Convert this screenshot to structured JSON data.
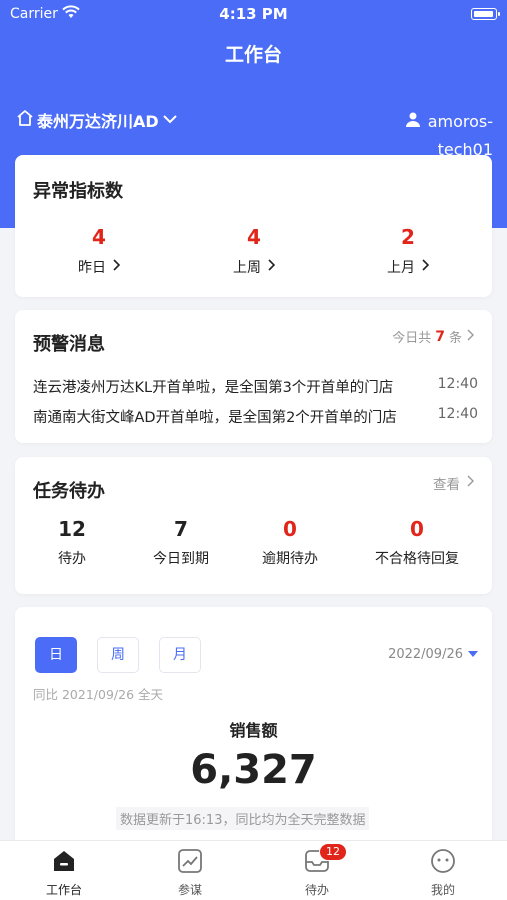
{
  "status_bar": {
    "carrier": "Carrier",
    "time": "4:13 PM"
  },
  "nav": {
    "title": "工作台"
  },
  "store": {
    "name": "泰州万达济川AD"
  },
  "user": {
    "name_line1": "amoros-",
    "name_line2": "tech01"
  },
  "abnormal": {
    "title": "异常指标数",
    "items": [
      {
        "value": "4",
        "label": "昨日"
      },
      {
        "value": "4",
        "label": "上周"
      },
      {
        "value": "2",
        "label": "上月"
      }
    ]
  },
  "alerts": {
    "title": "预警消息",
    "count_prefix": "今日共",
    "count": "7",
    "count_suffix": "条",
    "items": [
      {
        "text": "连云港凌州万达KL开首单啦，是全国第3个开首单的门店",
        "time": "12:40"
      },
      {
        "text": "南通南大街文峰AD开首单啦，是全国第2个开首单的门店",
        "time": "12:40"
      }
    ]
  },
  "tasks": {
    "title": "任务待办",
    "view_label": "查看",
    "items": [
      {
        "value": "12",
        "label": "待办",
        "color": "#222222"
      },
      {
        "value": "7",
        "label": "今日到期",
        "color": "#222222"
      },
      {
        "value": "0",
        "label": "逾期待办",
        "color": "#e1251b"
      },
      {
        "value": "0",
        "label": "不合格待回复",
        "color": "#e1251b"
      }
    ]
  },
  "sales": {
    "periods": [
      "日",
      "周",
      "月"
    ],
    "selected_period": "日",
    "date": "2022/09/26",
    "compare_text": "同比 2021/09/26 全天",
    "metric_name": "销售额",
    "metric_value": "6,327",
    "update_note": "数据更新于16:13，同比均为全天完整数据"
  },
  "tab_bar": {
    "items": [
      {
        "label": "工作台",
        "icon": "home-icon",
        "active": true
      },
      {
        "label": "参谋",
        "icon": "chart-icon",
        "active": false
      },
      {
        "label": "待办",
        "icon": "inbox-icon",
        "active": false,
        "badge": "12"
      },
      {
        "label": "我的",
        "icon": "face-icon",
        "active": false
      }
    ]
  },
  "colors": {
    "primary": "#4a6cf7",
    "alert": "#e1251b"
  }
}
